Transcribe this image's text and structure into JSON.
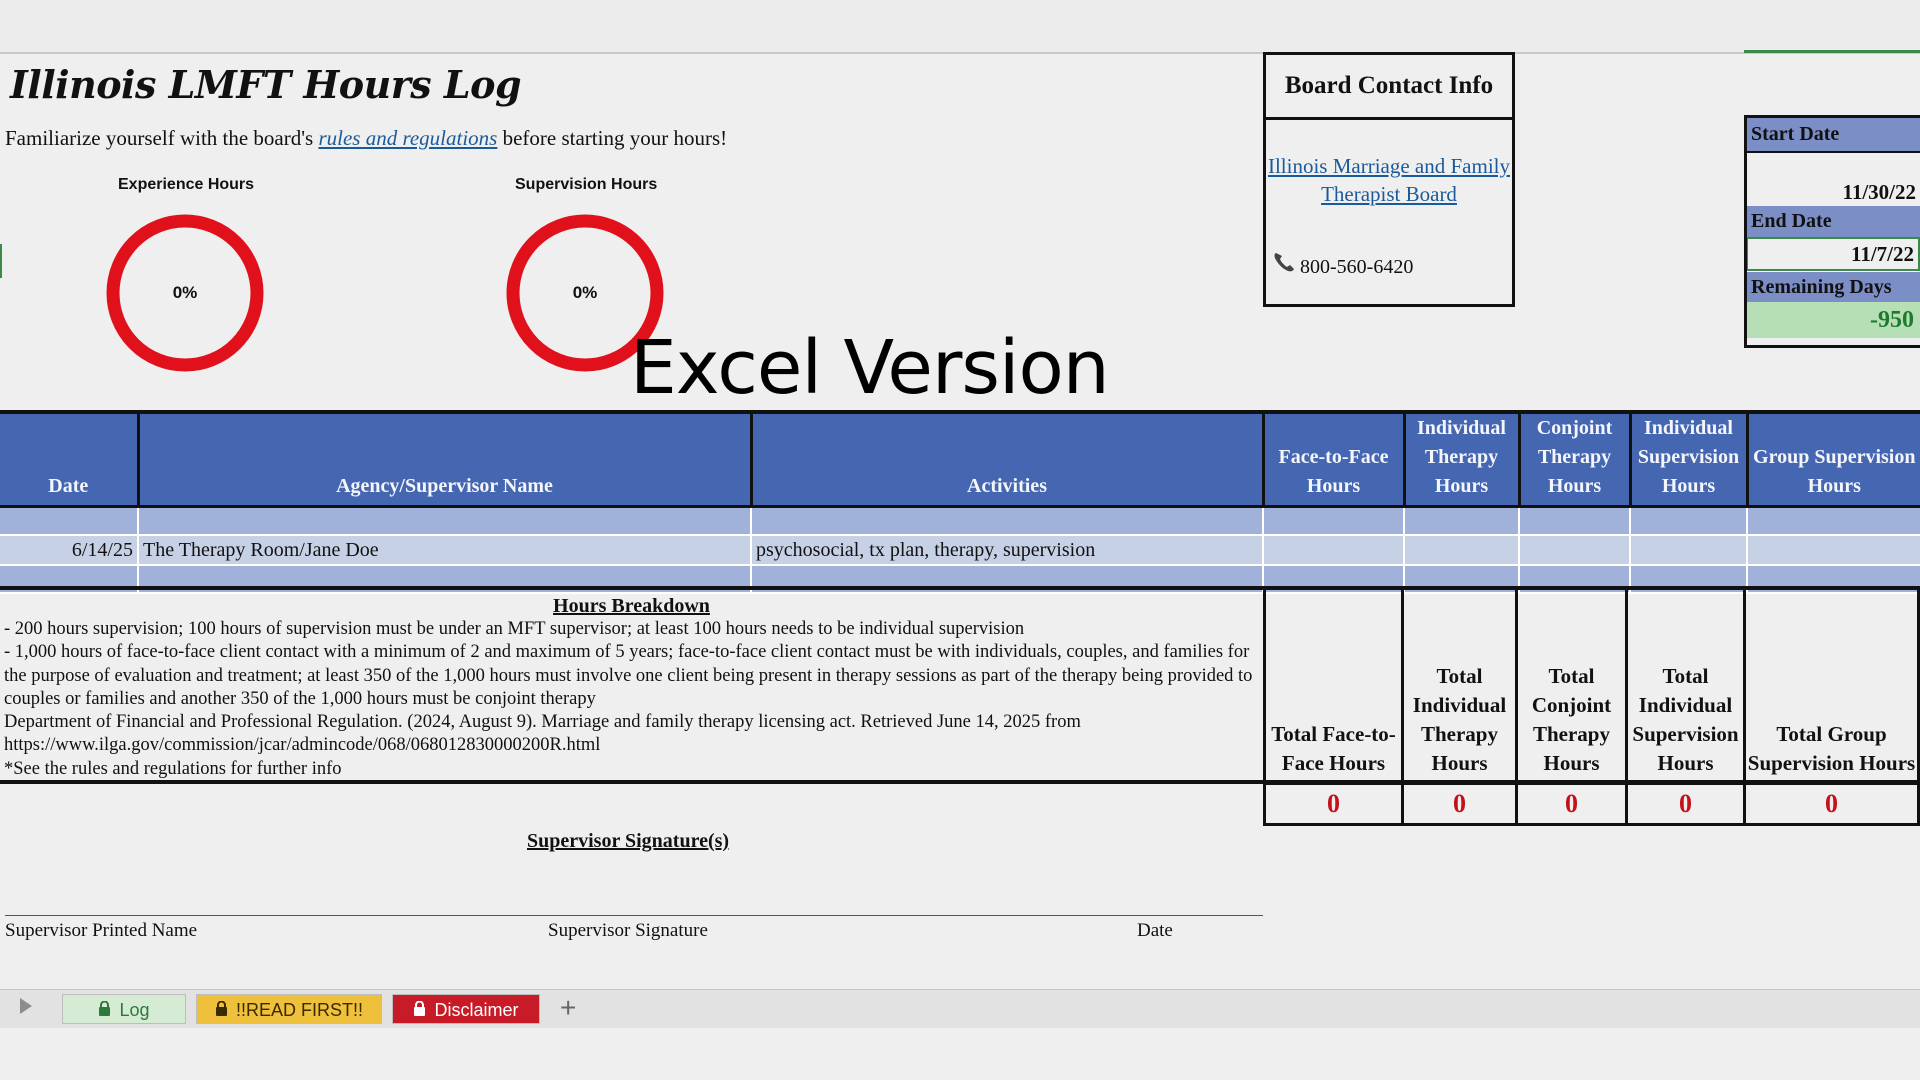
{
  "sheet": {
    "title": "Illinois LMFT Hours Log",
    "intro_before": "Familiarize yourself with the board's ",
    "intro_link": "rules and regulations",
    "intro_after": " before starting your hours!",
    "overlay_caption": "Excel Version"
  },
  "donuts": [
    {
      "label": "Experience Hours",
      "percent_text": "0%",
      "fraction": 0.0,
      "color": "#e0111b"
    },
    {
      "label": "Supervision Hours",
      "percent_text": "0%",
      "fraction": 0.0,
      "color": "#e0111b"
    }
  ],
  "contact": {
    "header": "Board Contact Info",
    "board_link": "Illinois Marriage and Family Therapist Board",
    "phone": "800-560-6420",
    "phone_icon": "phone-icon"
  },
  "dates": {
    "start_label": "Start Date",
    "start_value": "11/30/22",
    "end_label": "End Date",
    "end_value": "11/7/22",
    "remaining_label": "Remaining Days",
    "remaining_value": "-950"
  },
  "log": {
    "columns": [
      "Date",
      "Agency/Supervisor Name",
      "Activities",
      "Face-to-Face Hours",
      "Individual Therapy Hours",
      "Conjoint Therapy Hours",
      "Individual Supervision Hours",
      "Group Supervision Hours"
    ],
    "rows": [
      {
        "date": "",
        "agency": "",
        "activities": "",
        "f2f": "",
        "ind": "",
        "conj": "",
        "isup": "",
        "gsup": ""
      },
      {
        "date": "6/14/25",
        "agency": "The Therapy Room/Jane Doe",
        "activities": "psychosocial, tx plan, therapy, supervision",
        "f2f": "",
        "ind": "",
        "conj": "",
        "isup": "",
        "gsup": ""
      },
      {
        "date": "",
        "agency": "",
        "activities": "",
        "f2f": "",
        "ind": "",
        "conj": "",
        "isup": "",
        "gsup": ""
      }
    ]
  },
  "breakdown": {
    "heading": "Hours Breakdown",
    "lines": [
      "- 200 hours supervision; 100 hours of supervision must be under an MFT supervisor; at least 100 hours needs to be individual supervision",
      "- 1,000 hours of face-to-face client contact with a minimum of 2 and maximum of 5 years; face-to-face client contact must be with individuals, couples, and families for the purpose of evaluation and treatment; at least 350 of the 1,000 hours must involve one client being present in therapy sessions as part of the therapy being provided to couples or families and another 350 of the 1,000 hours must be conjoint therapy",
      "Department of Financial and Professional Regulation. (2024, August 9). Marriage and family therapy licensing act. Retrieved June 14, 2025 from https://www.ilga.gov/commission/jcar/admincode/068/068012830000200R.html",
      "*See the rules and regulations for further info"
    ]
  },
  "totals": [
    {
      "label": "Total Face-to-Face Hours",
      "value": "0"
    },
    {
      "label": "Total Individual Therapy Hours",
      "value": "0"
    },
    {
      "label": "Total Conjoint Therapy Hours",
      "value": "0"
    },
    {
      "label": "Total Individual Supervision Hours",
      "value": "0"
    },
    {
      "label": "Total Group Supervision Hours",
      "value": "0"
    }
  ],
  "signatures": {
    "heading": "Supervisor Signature(s)",
    "printed_name": "Supervisor Printed Name",
    "signature": "Supervisor Signature",
    "date": "Date"
  },
  "tabs": [
    {
      "label": "Log",
      "bg": "#d5ebd3",
      "fg": "#2d7a3a",
      "active": true
    },
    {
      "label": "!!READ FIRST!!",
      "bg": "#efc03b",
      "fg": "#3a2a00",
      "active": false
    },
    {
      "label": "Disclaimer",
      "bg": "#c81b28",
      "fg": "#ffffff",
      "active": false
    }
  ],
  "add_sheet": "+"
}
